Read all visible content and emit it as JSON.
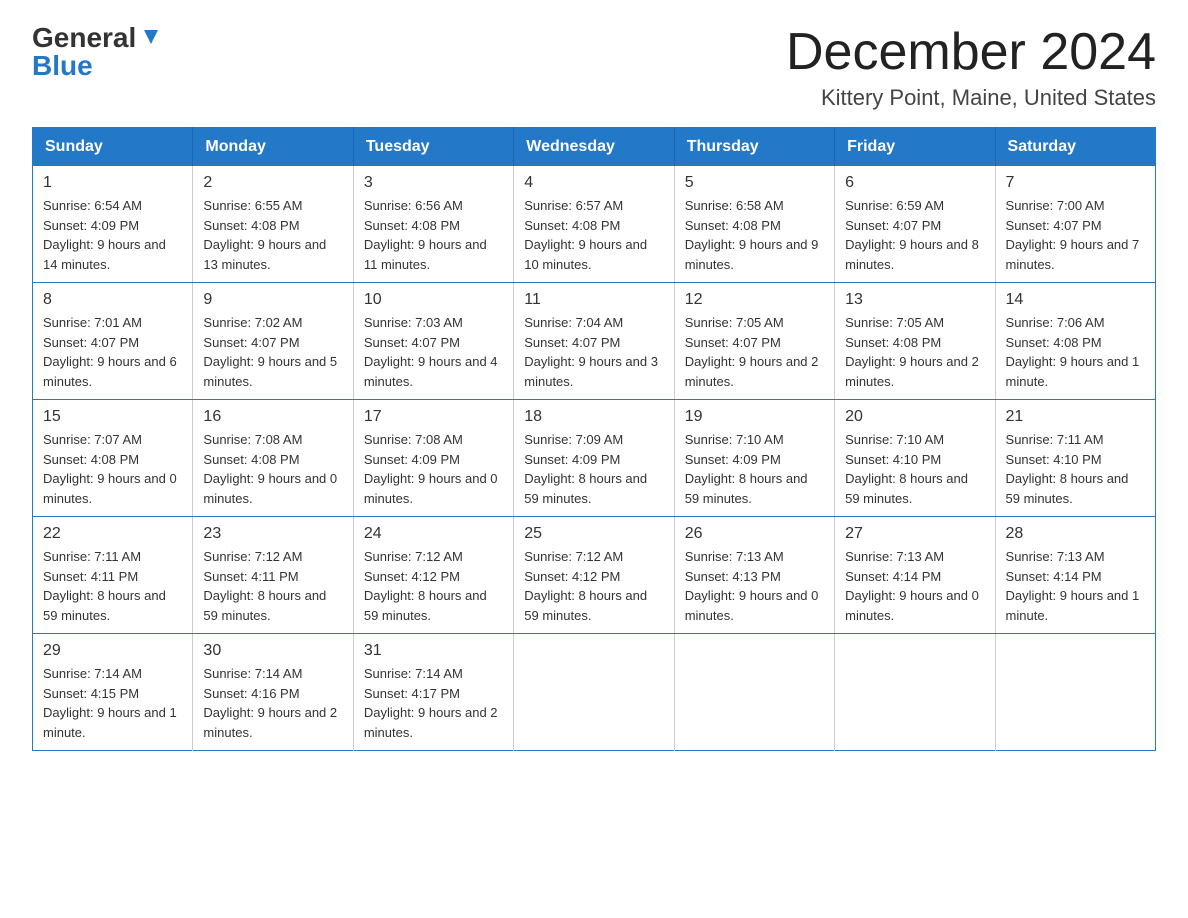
{
  "header": {
    "logo_line1": "General",
    "logo_line2": "Blue",
    "month_title": "December 2024",
    "location": "Kittery Point, Maine, United States"
  },
  "days_of_week": [
    "Sunday",
    "Monday",
    "Tuesday",
    "Wednesday",
    "Thursday",
    "Friday",
    "Saturday"
  ],
  "weeks": [
    [
      {
        "day": "1",
        "sunrise": "6:54 AM",
        "sunset": "4:09 PM",
        "daylight": "9 hours and 14 minutes."
      },
      {
        "day": "2",
        "sunrise": "6:55 AM",
        "sunset": "4:08 PM",
        "daylight": "9 hours and 13 minutes."
      },
      {
        "day": "3",
        "sunrise": "6:56 AM",
        "sunset": "4:08 PM",
        "daylight": "9 hours and 11 minutes."
      },
      {
        "day": "4",
        "sunrise": "6:57 AM",
        "sunset": "4:08 PM",
        "daylight": "9 hours and 10 minutes."
      },
      {
        "day": "5",
        "sunrise": "6:58 AM",
        "sunset": "4:08 PM",
        "daylight": "9 hours and 9 minutes."
      },
      {
        "day": "6",
        "sunrise": "6:59 AM",
        "sunset": "4:07 PM",
        "daylight": "9 hours and 8 minutes."
      },
      {
        "day": "7",
        "sunrise": "7:00 AM",
        "sunset": "4:07 PM",
        "daylight": "9 hours and 7 minutes."
      }
    ],
    [
      {
        "day": "8",
        "sunrise": "7:01 AM",
        "sunset": "4:07 PM",
        "daylight": "9 hours and 6 minutes."
      },
      {
        "day": "9",
        "sunrise": "7:02 AM",
        "sunset": "4:07 PM",
        "daylight": "9 hours and 5 minutes."
      },
      {
        "day": "10",
        "sunrise": "7:03 AM",
        "sunset": "4:07 PM",
        "daylight": "9 hours and 4 minutes."
      },
      {
        "day": "11",
        "sunrise": "7:04 AM",
        "sunset": "4:07 PM",
        "daylight": "9 hours and 3 minutes."
      },
      {
        "day": "12",
        "sunrise": "7:05 AM",
        "sunset": "4:07 PM",
        "daylight": "9 hours and 2 minutes."
      },
      {
        "day": "13",
        "sunrise": "7:05 AM",
        "sunset": "4:08 PM",
        "daylight": "9 hours and 2 minutes."
      },
      {
        "day": "14",
        "sunrise": "7:06 AM",
        "sunset": "4:08 PM",
        "daylight": "9 hours and 1 minute."
      }
    ],
    [
      {
        "day": "15",
        "sunrise": "7:07 AM",
        "sunset": "4:08 PM",
        "daylight": "9 hours and 0 minutes."
      },
      {
        "day": "16",
        "sunrise": "7:08 AM",
        "sunset": "4:08 PM",
        "daylight": "9 hours and 0 minutes."
      },
      {
        "day": "17",
        "sunrise": "7:08 AM",
        "sunset": "4:09 PM",
        "daylight": "9 hours and 0 minutes."
      },
      {
        "day": "18",
        "sunrise": "7:09 AM",
        "sunset": "4:09 PM",
        "daylight": "8 hours and 59 minutes."
      },
      {
        "day": "19",
        "sunrise": "7:10 AM",
        "sunset": "4:09 PM",
        "daylight": "8 hours and 59 minutes."
      },
      {
        "day": "20",
        "sunrise": "7:10 AM",
        "sunset": "4:10 PM",
        "daylight": "8 hours and 59 minutes."
      },
      {
        "day": "21",
        "sunrise": "7:11 AM",
        "sunset": "4:10 PM",
        "daylight": "8 hours and 59 minutes."
      }
    ],
    [
      {
        "day": "22",
        "sunrise": "7:11 AM",
        "sunset": "4:11 PM",
        "daylight": "8 hours and 59 minutes."
      },
      {
        "day": "23",
        "sunrise": "7:12 AM",
        "sunset": "4:11 PM",
        "daylight": "8 hours and 59 minutes."
      },
      {
        "day": "24",
        "sunrise": "7:12 AM",
        "sunset": "4:12 PM",
        "daylight": "8 hours and 59 minutes."
      },
      {
        "day": "25",
        "sunrise": "7:12 AM",
        "sunset": "4:12 PM",
        "daylight": "8 hours and 59 minutes."
      },
      {
        "day": "26",
        "sunrise": "7:13 AM",
        "sunset": "4:13 PM",
        "daylight": "9 hours and 0 minutes."
      },
      {
        "day": "27",
        "sunrise": "7:13 AM",
        "sunset": "4:14 PM",
        "daylight": "9 hours and 0 minutes."
      },
      {
        "day": "28",
        "sunrise": "7:13 AM",
        "sunset": "4:14 PM",
        "daylight": "9 hours and 1 minute."
      }
    ],
    [
      {
        "day": "29",
        "sunrise": "7:14 AM",
        "sunset": "4:15 PM",
        "daylight": "9 hours and 1 minute."
      },
      {
        "day": "30",
        "sunrise": "7:14 AM",
        "sunset": "4:16 PM",
        "daylight": "9 hours and 2 minutes."
      },
      {
        "day": "31",
        "sunrise": "7:14 AM",
        "sunset": "4:17 PM",
        "daylight": "9 hours and 2 minutes."
      },
      null,
      null,
      null,
      null
    ]
  ],
  "labels": {
    "sunrise": "Sunrise: ",
    "sunset": "Sunset: ",
    "daylight": "Daylight: "
  }
}
